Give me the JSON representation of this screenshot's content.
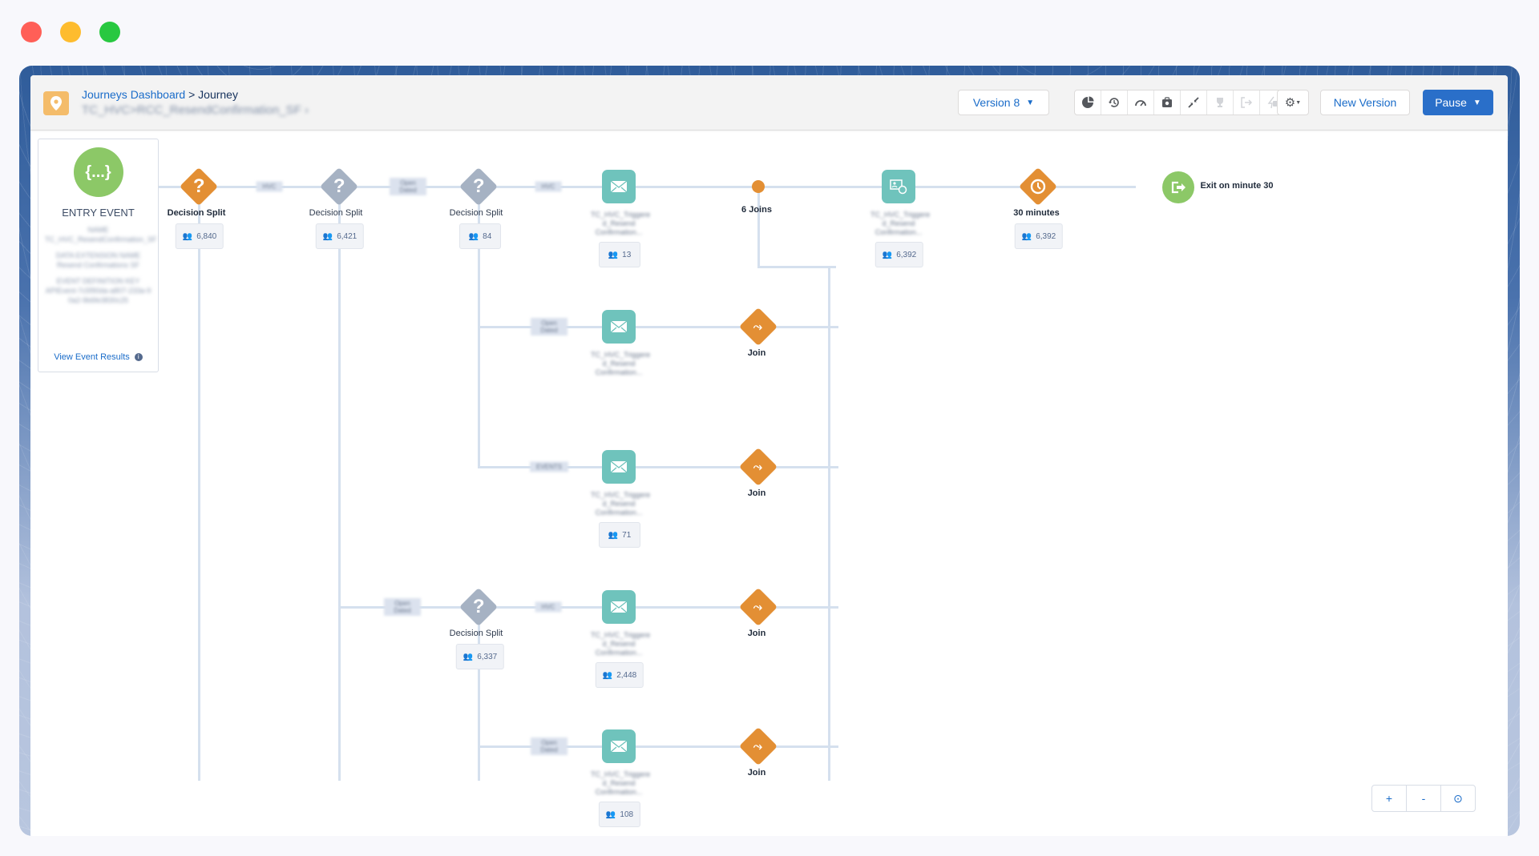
{
  "window": {
    "traffic_lights": [
      {
        "name": "close",
        "color": "#ff5f57"
      },
      {
        "name": "minimize",
        "color": "#febc2e"
      },
      {
        "name": "maximize",
        "color": "#28c840"
      }
    ]
  },
  "header": {
    "breadcrumb_link": "Journeys Dashboard",
    "breadcrumb_separator": ">",
    "breadcrumb_current": "Journey",
    "journey_name": "TC_HVC>RCC_ResendConfirmation_SF",
    "journey_name_chevron": "›",
    "version_label": "Version 8",
    "toolbar_icons": [
      "pie-chart-icon",
      "history-icon",
      "gauge-icon",
      "camera-icon",
      "collapse-icon",
      "trophy-icon",
      "exit-criteria-icon",
      "goal-exit-icon"
    ],
    "settings_icon": "gear-icon",
    "new_version_label": "New Version",
    "pause_label": "Pause",
    "colors": {
      "primary": "#2a6fc9",
      "link": "#1a6cc9"
    }
  },
  "entry_event": {
    "title": "ENTRY EVENT",
    "icon": "{...}",
    "name_label": "NAME",
    "name_value": "TC_HVC_ResendConfirmation_SF",
    "de_label": "DATA EXTENSION NAME",
    "de_value": "Resend Confirmations SF",
    "key_label": "EVENT DEFINITION KEY",
    "key_value": "APIEvent-7c5f90da-a807-233a-90a2-9b6fe3830c25",
    "view_results": "View Event Results",
    "info": "i"
  },
  "nodes": {
    "split1": {
      "label": "Decision Split",
      "count": "6,840"
    },
    "split2": {
      "label": "Decision Split",
      "count": "6,421"
    },
    "split3": {
      "label": "Decision Split",
      "count": "84"
    },
    "split4": {
      "label": "Decision Split",
      "count": "6,337"
    },
    "email1": {
      "name": "TC_HVC_Triggere d_Resend Confirmation...",
      "count": "13"
    },
    "email2": {
      "name": "TC_HVC_Triggere d_Resend Confirmation..."
    },
    "email3": {
      "name": "TC_HVC_Triggere d_Resend Confirmation...",
      "count": "71"
    },
    "email4": {
      "name": "TC_HVC_Triggere d_Resend Confirmation...",
      "count": "2,448"
    },
    "email5": {
      "name": "TC_HVC_Triggere d_Resend Confirmation...",
      "count": "108"
    },
    "joins": {
      "label": "6 Joins"
    },
    "join1": {
      "label": "Join"
    },
    "join2": {
      "label": "Join"
    },
    "join3": {
      "label": "Join"
    },
    "join4": {
      "label": "Join"
    },
    "sitemsg": {
      "name": "TC_HVC_Triggere d_Resend Confirmation...",
      "count": "6,392"
    },
    "wait": {
      "label": "30 minutes",
      "count": "6,392"
    },
    "exit": {
      "label": "Exit on minute 30"
    }
  },
  "path_labels": {
    "p1": "HVC",
    "p2": "Open Dated",
    "p3": "HVC",
    "p4": "Open Dated",
    "p5": "EVENTS",
    "p6": "Open Dated",
    "p7": "HVC",
    "p8": "Open Dated"
  },
  "zoom_controls": {
    "zoom_in": "+",
    "zoom_out": "-",
    "recenter": "⊙"
  }
}
